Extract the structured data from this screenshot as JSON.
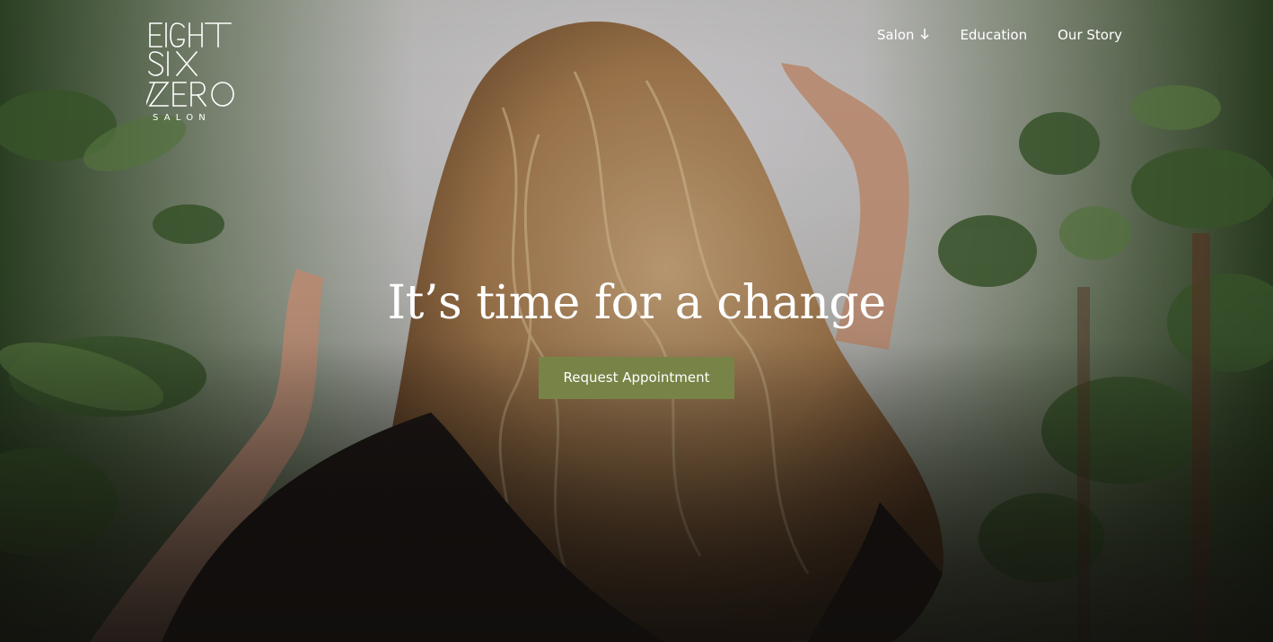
{
  "brand": {
    "logo_lines": [
      "EIGHT",
      "SIX",
      "ZERO"
    ],
    "logo_sub": "SALON"
  },
  "nav": {
    "items": [
      {
        "label": "Salon",
        "icon": "arrow-down-icon"
      },
      {
        "label": "Education"
      },
      {
        "label": "Our Story"
      }
    ]
  },
  "hero": {
    "headline": "It’s time for a change",
    "cta_label": "Request Appointment",
    "background_description_icon": "hero-photo-woman-wavy-hair-foliage"
  },
  "colors": {
    "accent": "#788447",
    "text_light": "#ffffff"
  }
}
